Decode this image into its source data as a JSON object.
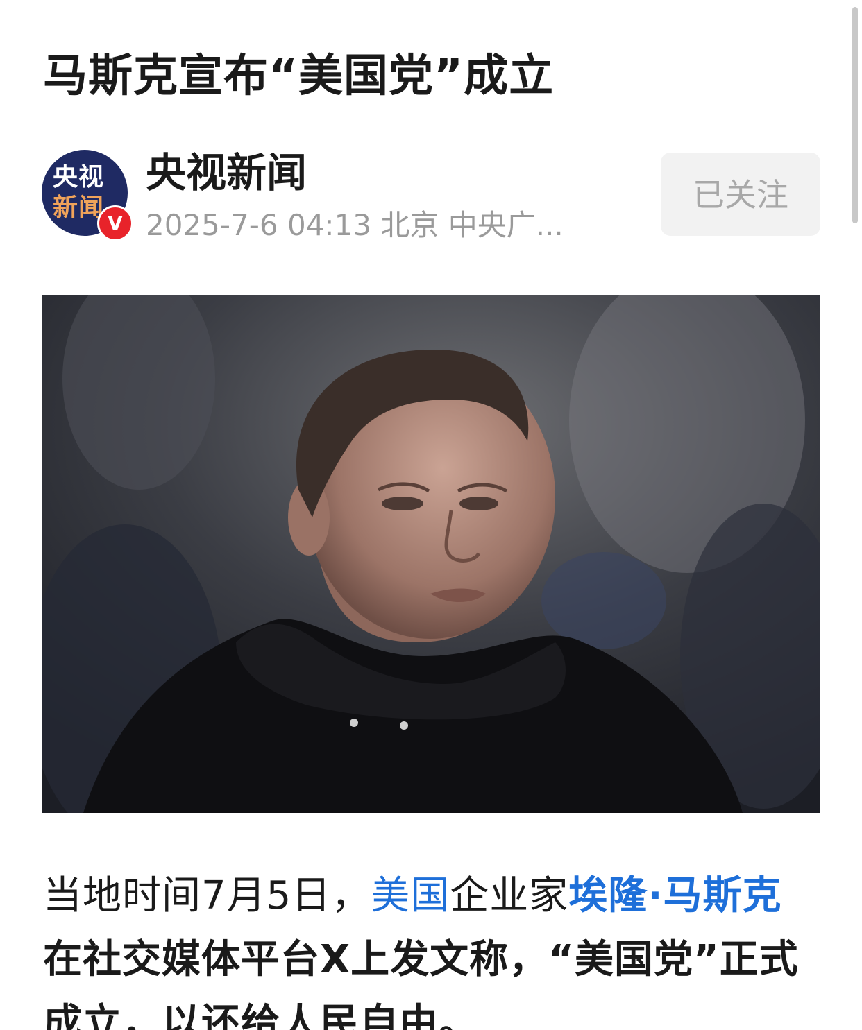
{
  "article": {
    "title": "马斯克宣布“美国党”成立",
    "author": {
      "name": "央视新闻",
      "avatar_logo_line1": "央视",
      "avatar_logo_line2": "新闻",
      "verified_badge": "V",
      "meta": "2025-7-6 04:13 北京 中央广..."
    },
    "follow_button_label": "已关注",
    "body": {
      "p1_s1": "当地时间7月5日，",
      "p1_link_country": "美国",
      "p1_s2": "企业家",
      "p1_link_person": "埃隆·马斯克",
      "p1_s3": "在社交媒体平台X上发文称，“美国党”正式成立，以还给人民自由。"
    }
  },
  "icons": {
    "verified": "verified-v-icon"
  },
  "colors": {
    "link": "#1e6fd9",
    "meta_gray": "#9a9a9a",
    "follow_bg": "#f2f2f2",
    "avatar_bg": "#1f2a63",
    "verified_red": "#e8232a"
  }
}
